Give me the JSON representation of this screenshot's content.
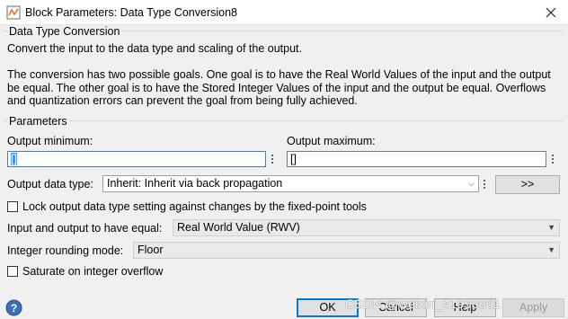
{
  "window": {
    "title": "Block Parameters: Data Type Conversion8"
  },
  "description": {
    "group_label": "Data Type Conversion",
    "line1": "Convert the input to the data type and scaling of the output.",
    "paragraph": "The conversion has two possible goals. One goal is to have the Real World Values of the input and the output be equal.  The other goal is to have the Stored Integer Values of the input and the output be equal. Overflows and quantization errors can prevent the goal from being fully achieved."
  },
  "parameters": {
    "group_label": "Parameters",
    "output_minimum": {
      "label": "Output minimum:",
      "value": "[]"
    },
    "output_maximum": {
      "label": "Output maximum:",
      "value": "[]"
    },
    "output_data_type": {
      "label": "Output data type:",
      "value": "Inherit: Inherit via back propagation",
      "assistant_button": ">>"
    },
    "lock_output": {
      "label": "Lock output data type setting against changes by the fixed-point tools",
      "checked": false
    },
    "input_output_equal": {
      "label": "Input and output to have equal:",
      "value": "Real World Value (RWV)"
    },
    "rounding_mode": {
      "label": "Integer rounding mode:",
      "value": "Floor"
    },
    "saturate": {
      "label": "Saturate on integer overflow",
      "checked": false
    }
  },
  "buttons": {
    "ok": "OK",
    "cancel": "Cancel",
    "help": "Help",
    "apply": "Apply"
  },
  "watermark": "CSDN @weixin_41958861",
  "icons": {
    "app": "simulink-icon",
    "close": "close-icon",
    "help": "help-question-icon"
  },
  "colors": {
    "background": "#f0f0f0",
    "selection": "#3399ff",
    "default_button_border": "#0078d7"
  }
}
